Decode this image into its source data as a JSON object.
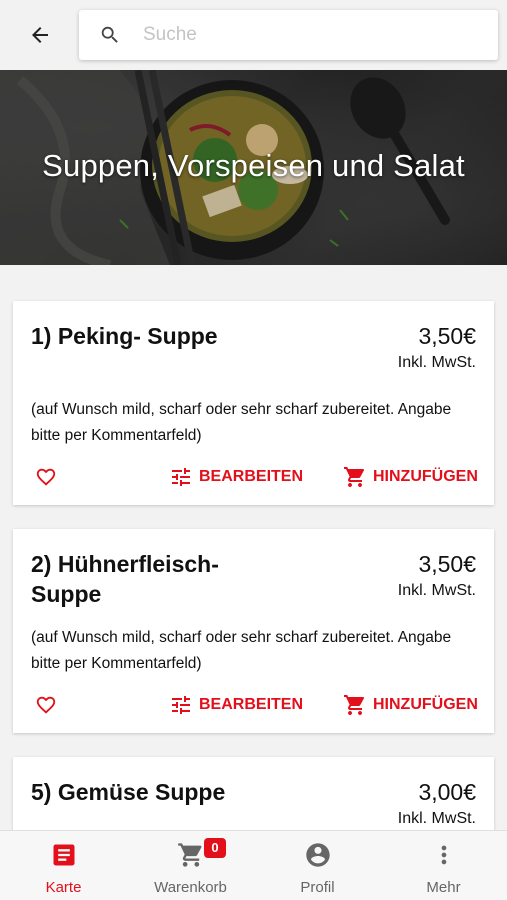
{
  "search": {
    "placeholder": "Suche"
  },
  "category": {
    "title": "Suppen, Vorspeisen und Salat"
  },
  "products": [
    {
      "name": "1) Peking- Suppe",
      "price": "3,50€",
      "tax_note": "Inkl. MwSt.",
      "description": "(auf Wunsch mild, scharf oder sehr scharf zubereitet. Angabe bitte per Kommentarfeld)",
      "edit_label": "BEARBEITEN",
      "add_label": "HINZUFÜGEN"
    },
    {
      "name": "2) Hühnerfleisch-Suppe",
      "price": "3,50€",
      "tax_note": "Inkl. MwSt.",
      "description": "(auf Wunsch mild, scharf oder sehr scharf zubereitet. Angabe bitte per Kommentarfeld)",
      "edit_label": "BEARBEITEN",
      "add_label": "HINZUFÜGEN"
    },
    {
      "name": "5) Gemüse Suppe",
      "price": "3,00€",
      "tax_note": "Inkl. MwSt."
    }
  ],
  "bottom_nav": {
    "items": [
      {
        "label": "Karte",
        "icon": "menu-card-icon",
        "active": true
      },
      {
        "label": "Warenkorb",
        "icon": "cart-icon",
        "badge": "0"
      },
      {
        "label": "Profil",
        "icon": "profile-icon"
      },
      {
        "label": "Mehr",
        "icon": "more-vert-icon"
      }
    ]
  },
  "colors": {
    "accent": "#e3101b",
    "background": "#f2f2f2",
    "card": "#ffffff",
    "inactive": "#666666"
  }
}
